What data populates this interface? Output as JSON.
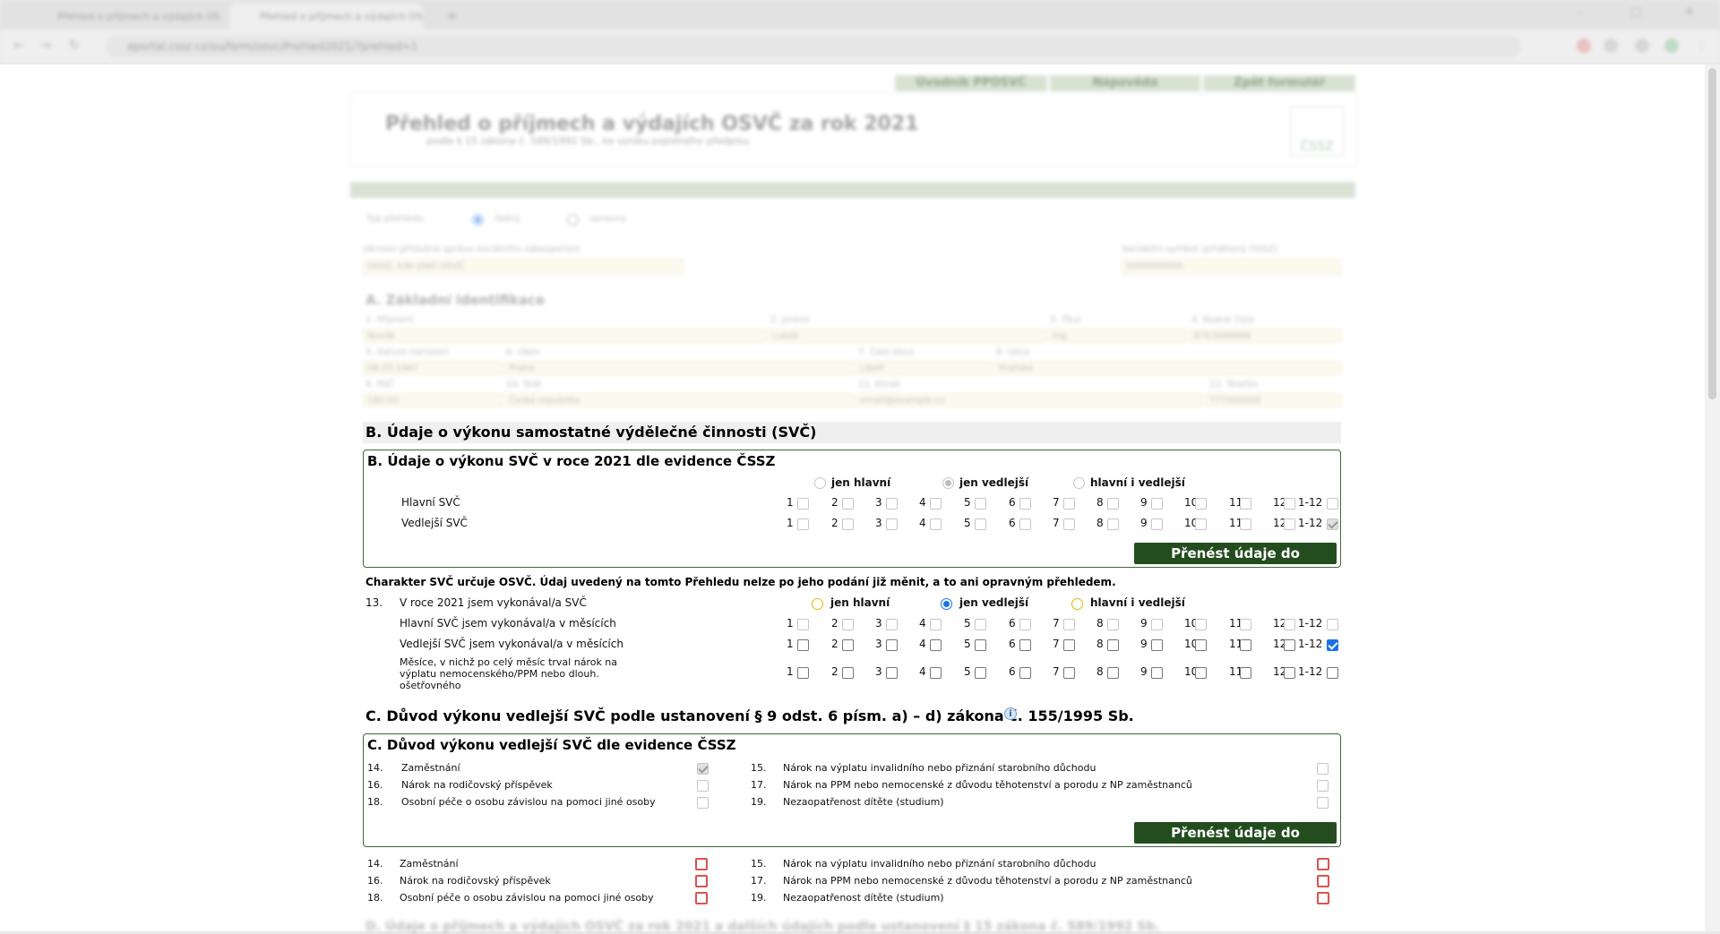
{
  "browser": {
    "tabs": [
      {
        "title": "Přehled o příjmech a výdajích OSVČ"
      },
      {
        "title": "Přehled o příjmech a výdajích OSVČ"
      }
    ],
    "url": "eportal.cssz.cz/ou/form/osvc/Prehled2021/?prehled=1"
  },
  "top_buttons": [
    "Úvodník PPOSVČ",
    "Nápověda",
    "Zpět formulář"
  ],
  "form_header": {
    "title": "Přehled o příjmech a výdajích OSVČ za rok 2021",
    "subtitle": "podle § 15 zákona č. 589/1992 Sb., ke vzniku pojistného předpisu",
    "logo_text": "ČSSZ"
  },
  "blurred_form": {
    "type_label": "Typ přehledu",
    "type_opt1": "řádný",
    "type_opt2": "opravný",
    "district_label": "Okresní příslušná správa sociálního zabezpečení",
    "district_value": "OSSZ, kde platí OSVČ",
    "vs_label": "Variabilní symbol (přidělený OSSZ)",
    "vs_value": "0000000000",
    "section_a": "A. Základní identifikace",
    "fields": [
      {
        "label": "1. Příjmení",
        "value": "Novák"
      },
      {
        "label": "2. Jméno",
        "value": "Lukáš"
      },
      {
        "label": "3. Titul",
        "value": "Ing."
      },
      {
        "label": "4. Rodné číslo",
        "value": "8703088998"
      },
      {
        "label": "5. Datum narození",
        "value": "08.03.1987"
      },
      {
        "label": "6. Obec",
        "value": "Praha"
      },
      {
        "label": "7. Část obce",
        "value": "Libeň"
      },
      {
        "label": "8. Ulice",
        "value": "Pražská"
      },
      {
        "label": "9. PSČ",
        "value": "180 00"
      },
      {
        "label": "10. Stát",
        "value": "Česká republika"
      },
      {
        "label": "11. Email",
        "value": "email@example.cz"
      },
      {
        "label": "12. Telefon",
        "value": "777000000"
      }
    ]
  },
  "section_b": {
    "title": "B. Údaje o výkonu samostatné výdělečné činnosti (SVČ)",
    "panel_title": "B. Údaje o výkonu SVČ v roce 2021 dle evidence ČSSZ",
    "radio_labels": [
      "jen hlavní",
      "jen vedlejší",
      "hlavní i vedlejší"
    ],
    "row_main": "Hlavní SVČ",
    "row_side": "Vedlejší SVČ",
    "months": [
      "1",
      "2",
      "3",
      "4",
      "5",
      "6",
      "7",
      "8",
      "9",
      "10",
      "11",
      "12",
      "1-12"
    ],
    "transfer_button": "Přenést údaje do formuláře",
    "note": "Charakter SVČ určuje OSVČ. Údaj uvedený na tomto Přehledu nelze po jeho podání již měnit, a to ani opravným přehledem.",
    "q13_num": "13.",
    "q13_label": "V roce 2021 jsem vykonával/a SVČ",
    "q_main_months": "Hlavní SVČ jsem vykonával/a v měsících",
    "q_side_months": "Vedlejší SVČ jsem vykonával/a v měsících",
    "q_sick_line1": "Měsíce, v nichž po celý měsíc trval nárok na",
    "q_sick_line2": "výplatu nemocenského/PPM nebo dlouh.",
    "q_sick_line3": "ošetřovného"
  },
  "section_c": {
    "title": "C. Důvod výkonu vedlejší SVČ podle ustanovení § 9 odst. 6 písm. a) – d) zákona č. 155/1995 Sb.",
    "info_icon": "i",
    "panel_title": "C. Důvod výkonu vedlejší SVČ dle evidence ČSSZ",
    "items": [
      {
        "num": "14.",
        "label": "Zaměstnání"
      },
      {
        "num": "15.",
        "label": "Nárok na výplatu invalidního nebo přiznání starobního důchodu"
      },
      {
        "num": "16.",
        "label": "Nárok na rodičovský příspěvek"
      },
      {
        "num": "17.",
        "label": "Nárok na PPM nebo nemocenské z důvodu těhotenství a porodu z NP zaměstnanců"
      },
      {
        "num": "18.",
        "label": "Osobní péče o osobu závislou na pomoci jiné osoby"
      },
      {
        "num": "19.",
        "label": "Nezaopatřenost dítěte (studium)"
      }
    ],
    "transfer_button": "Přenést údaje do formuláře"
  },
  "section_d_partial": "D. Údaje o příjmech a výdajích OSVČ za rok 2021 a dalších údajích podle ustanovení § 15 zákona č. 589/1992 Sb."
}
